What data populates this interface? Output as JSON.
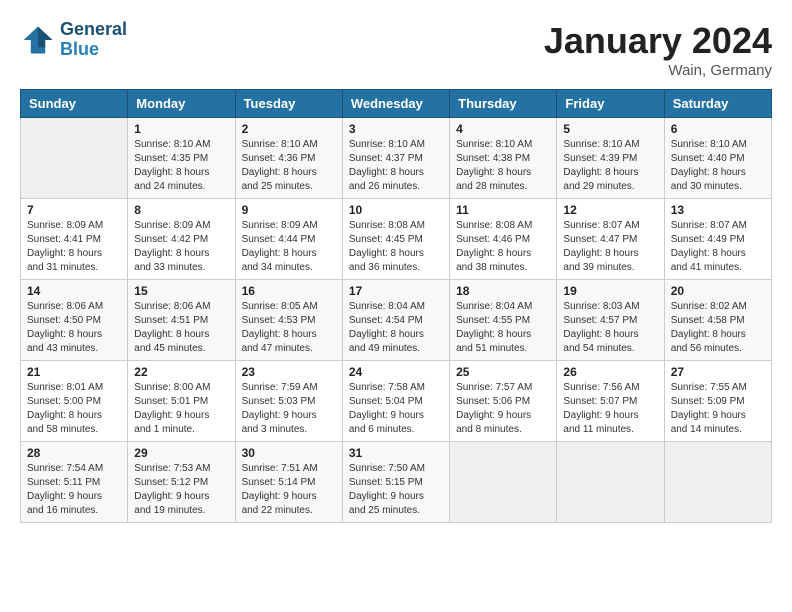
{
  "header": {
    "logo_line1": "General",
    "logo_line2": "Blue",
    "month": "January 2024",
    "location": "Wain, Germany"
  },
  "weekdays": [
    "Sunday",
    "Monday",
    "Tuesday",
    "Wednesday",
    "Thursday",
    "Friday",
    "Saturday"
  ],
  "weeks": [
    [
      {
        "day": "",
        "sunrise": "",
        "sunset": "",
        "daylight": ""
      },
      {
        "day": "1",
        "sunrise": "Sunrise: 8:10 AM",
        "sunset": "Sunset: 4:35 PM",
        "daylight": "Daylight: 8 hours and 24 minutes."
      },
      {
        "day": "2",
        "sunrise": "Sunrise: 8:10 AM",
        "sunset": "Sunset: 4:36 PM",
        "daylight": "Daylight: 8 hours and 25 minutes."
      },
      {
        "day": "3",
        "sunrise": "Sunrise: 8:10 AM",
        "sunset": "Sunset: 4:37 PM",
        "daylight": "Daylight: 8 hours and 26 minutes."
      },
      {
        "day": "4",
        "sunrise": "Sunrise: 8:10 AM",
        "sunset": "Sunset: 4:38 PM",
        "daylight": "Daylight: 8 hours and 28 minutes."
      },
      {
        "day": "5",
        "sunrise": "Sunrise: 8:10 AM",
        "sunset": "Sunset: 4:39 PM",
        "daylight": "Daylight: 8 hours and 29 minutes."
      },
      {
        "day": "6",
        "sunrise": "Sunrise: 8:10 AM",
        "sunset": "Sunset: 4:40 PM",
        "daylight": "Daylight: 8 hours and 30 minutes."
      }
    ],
    [
      {
        "day": "7",
        "sunrise": "Sunrise: 8:09 AM",
        "sunset": "Sunset: 4:41 PM",
        "daylight": "Daylight: 8 hours and 31 minutes."
      },
      {
        "day": "8",
        "sunrise": "Sunrise: 8:09 AM",
        "sunset": "Sunset: 4:42 PM",
        "daylight": "Daylight: 8 hours and 33 minutes."
      },
      {
        "day": "9",
        "sunrise": "Sunrise: 8:09 AM",
        "sunset": "Sunset: 4:44 PM",
        "daylight": "Daylight: 8 hours and 34 minutes."
      },
      {
        "day": "10",
        "sunrise": "Sunrise: 8:08 AM",
        "sunset": "Sunset: 4:45 PM",
        "daylight": "Daylight: 8 hours and 36 minutes."
      },
      {
        "day": "11",
        "sunrise": "Sunrise: 8:08 AM",
        "sunset": "Sunset: 4:46 PM",
        "daylight": "Daylight: 8 hours and 38 minutes."
      },
      {
        "day": "12",
        "sunrise": "Sunrise: 8:07 AM",
        "sunset": "Sunset: 4:47 PM",
        "daylight": "Daylight: 8 hours and 39 minutes."
      },
      {
        "day": "13",
        "sunrise": "Sunrise: 8:07 AM",
        "sunset": "Sunset: 4:49 PM",
        "daylight": "Daylight: 8 hours and 41 minutes."
      }
    ],
    [
      {
        "day": "14",
        "sunrise": "Sunrise: 8:06 AM",
        "sunset": "Sunset: 4:50 PM",
        "daylight": "Daylight: 8 hours and 43 minutes."
      },
      {
        "day": "15",
        "sunrise": "Sunrise: 8:06 AM",
        "sunset": "Sunset: 4:51 PM",
        "daylight": "Daylight: 8 hours and 45 minutes."
      },
      {
        "day": "16",
        "sunrise": "Sunrise: 8:05 AM",
        "sunset": "Sunset: 4:53 PM",
        "daylight": "Daylight: 8 hours and 47 minutes."
      },
      {
        "day": "17",
        "sunrise": "Sunrise: 8:04 AM",
        "sunset": "Sunset: 4:54 PM",
        "daylight": "Daylight: 8 hours and 49 minutes."
      },
      {
        "day": "18",
        "sunrise": "Sunrise: 8:04 AM",
        "sunset": "Sunset: 4:55 PM",
        "daylight": "Daylight: 8 hours and 51 minutes."
      },
      {
        "day": "19",
        "sunrise": "Sunrise: 8:03 AM",
        "sunset": "Sunset: 4:57 PM",
        "daylight": "Daylight: 8 hours and 54 minutes."
      },
      {
        "day": "20",
        "sunrise": "Sunrise: 8:02 AM",
        "sunset": "Sunset: 4:58 PM",
        "daylight": "Daylight: 8 hours and 56 minutes."
      }
    ],
    [
      {
        "day": "21",
        "sunrise": "Sunrise: 8:01 AM",
        "sunset": "Sunset: 5:00 PM",
        "daylight": "Daylight: 8 hours and 58 minutes."
      },
      {
        "day": "22",
        "sunrise": "Sunrise: 8:00 AM",
        "sunset": "Sunset: 5:01 PM",
        "daylight": "Daylight: 9 hours and 1 minute."
      },
      {
        "day": "23",
        "sunrise": "Sunrise: 7:59 AM",
        "sunset": "Sunset: 5:03 PM",
        "daylight": "Daylight: 9 hours and 3 minutes."
      },
      {
        "day": "24",
        "sunrise": "Sunrise: 7:58 AM",
        "sunset": "Sunset: 5:04 PM",
        "daylight": "Daylight: 9 hours and 6 minutes."
      },
      {
        "day": "25",
        "sunrise": "Sunrise: 7:57 AM",
        "sunset": "Sunset: 5:06 PM",
        "daylight": "Daylight: 9 hours and 8 minutes."
      },
      {
        "day": "26",
        "sunrise": "Sunrise: 7:56 AM",
        "sunset": "Sunset: 5:07 PM",
        "daylight": "Daylight: 9 hours and 11 minutes."
      },
      {
        "day": "27",
        "sunrise": "Sunrise: 7:55 AM",
        "sunset": "Sunset: 5:09 PM",
        "daylight": "Daylight: 9 hours and 14 minutes."
      }
    ],
    [
      {
        "day": "28",
        "sunrise": "Sunrise: 7:54 AM",
        "sunset": "Sunset: 5:11 PM",
        "daylight": "Daylight: 9 hours and 16 minutes."
      },
      {
        "day": "29",
        "sunrise": "Sunrise: 7:53 AM",
        "sunset": "Sunset: 5:12 PM",
        "daylight": "Daylight: 9 hours and 19 minutes."
      },
      {
        "day": "30",
        "sunrise": "Sunrise: 7:51 AM",
        "sunset": "Sunset: 5:14 PM",
        "daylight": "Daylight: 9 hours and 22 minutes."
      },
      {
        "day": "31",
        "sunrise": "Sunrise: 7:50 AM",
        "sunset": "Sunset: 5:15 PM",
        "daylight": "Daylight: 9 hours and 25 minutes."
      },
      {
        "day": "",
        "sunrise": "",
        "sunset": "",
        "daylight": ""
      },
      {
        "day": "",
        "sunrise": "",
        "sunset": "",
        "daylight": ""
      },
      {
        "day": "",
        "sunrise": "",
        "sunset": "",
        "daylight": ""
      }
    ]
  ]
}
